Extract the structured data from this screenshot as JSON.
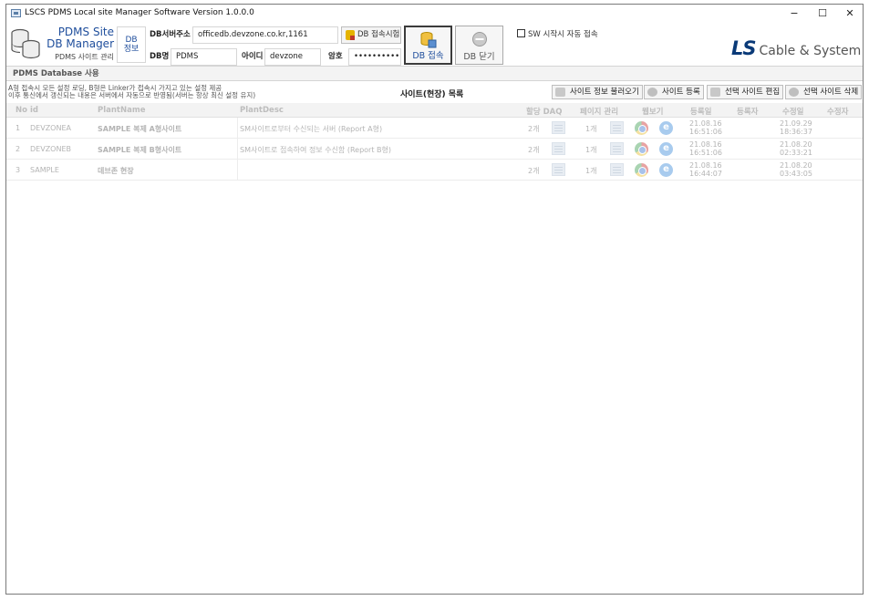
{
  "window": {
    "title": "LSCS PDMS Local site Manager Software Version 1.0.0.0",
    "controls": {
      "minimize": "−",
      "maximize": "☐",
      "close": "✕"
    }
  },
  "header": {
    "site_title_line1": "PDMS Site",
    "site_title_line2": "DB Manager",
    "site_subtitle": "PDMS 사이트 관리",
    "db_info_label_1": "DB",
    "db_info_label_2": "정보",
    "fields": {
      "server_label": "DB서버주소",
      "server_value": "officedb.devzone.co.kr,1161",
      "dbname_label": "DB명",
      "dbname_value": "PDMS",
      "id_label": "아이디",
      "id_value": "devzone",
      "pw_label": "암호",
      "pw_value": "•••••••••••"
    },
    "test_button": "DB 접속시험",
    "connect_button": "DB 접속",
    "close_button": "DB 닫기",
    "auto_connect_checkbox": "SW 시작시 자동 접속",
    "auto_connect_checked": false,
    "brand_ls": "LS",
    "brand_rest": "Cable & System"
  },
  "section_title": "PDMS Database 사용",
  "notes": {
    "line1": "A형 접속시 모든 설정 로딩, B형은 Linker가 접속시 가지고 있는 설정 제공",
    "line2": "이후 통신에서 갱신되는 내용은 서버에서 자동으로 반영됨(서버는 항상 최신 설정 유지)"
  },
  "list_title": "사이트(현장) 목록",
  "toolbar": {
    "load": "사이트 정보 불러오기",
    "register": "사이트 등록",
    "edit": "선택 사이트 편집",
    "delete": "선택 사이트 삭제"
  },
  "table": {
    "columns": [
      "No",
      "id",
      "PlantName",
      "PlantDesc",
      "할당 DAQ",
      "페이지 관리",
      "웹보기",
      "등록일",
      "등록자",
      "수정일",
      "수정자"
    ],
    "rows": [
      {
        "no": "1",
        "id": "DEVZONEA",
        "name": "SAMPLE 복제 A형사이트",
        "desc": "SM사이트로부터 수신되는 서버 (Report A형)",
        "daq": "2개",
        "pages": "1개",
        "reg_date": "21.08.16",
        "reg_time": "16:51:06",
        "reg_user": "",
        "mod_date": "21.09.29",
        "mod_time": "18:36:37",
        "mod_user": ""
      },
      {
        "no": "2",
        "id": "DEVZONEB",
        "name": "SAMPLE 복제 B형사이트",
        "desc": "SM사이트로 접속하여 정보 수신함 (Report B형)",
        "daq": "2개",
        "pages": "1개",
        "reg_date": "21.08.16",
        "reg_time": "16:51:06",
        "reg_user": "",
        "mod_date": "21.08.20",
        "mod_time": "02:33:21",
        "mod_user": ""
      },
      {
        "no": "3",
        "id": "SAMPLE",
        "name": "데브존 현장",
        "desc": "",
        "daq": "2개",
        "pages": "1개",
        "reg_date": "21.08.16",
        "reg_time": "16:44:07",
        "reg_user": "",
        "mod_date": "21.08.20",
        "mod_time": "03:43:05",
        "mod_user": ""
      }
    ]
  },
  "colors": {
    "brand_blue": "#0a3a78",
    "title_blue": "#1f4e9c"
  }
}
